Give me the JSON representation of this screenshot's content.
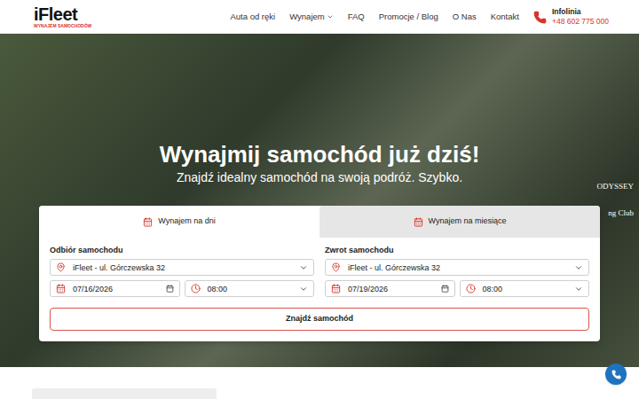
{
  "logo": {
    "brand": "iFleet",
    "tagline": "WYNAJEM SAMOCHODÓW"
  },
  "nav": [
    {
      "label": "Auta od ręki",
      "dropdown": false
    },
    {
      "label": "Wynajem",
      "dropdown": true
    },
    {
      "label": "FAQ",
      "dropdown": false
    },
    {
      "label": "Promocje / Blog",
      "dropdown": false
    },
    {
      "label": "O Nas",
      "dropdown": false
    },
    {
      "label": "Kontakt",
      "dropdown": false
    }
  ],
  "hotline": {
    "label": "Infolinia",
    "number": "+48 602 775 000"
  },
  "hero": {
    "title": "Wynajmij samochód już dziś!",
    "subtitle": "Znajdź idealny samochód na swoją podróż. Szybko."
  },
  "tabs": [
    {
      "label": "Wynajem na dni",
      "selected": true
    },
    {
      "label": "Wynajem na miesiące",
      "selected": false
    }
  ],
  "pickup": {
    "label": "Odbiór samochodu",
    "location": "iFleet - ul. Górczewska 32",
    "date": "07/16/2026",
    "time": "08:00"
  },
  "return": {
    "label": "Zwrot samochodu",
    "location": "iFleet - ul. Górczewska 32",
    "date": "07/19/2026",
    "time": "08:00"
  },
  "search_button": "Znajdź samochód",
  "partners": [
    "ODYSSEY",
    "ng Club"
  ]
}
